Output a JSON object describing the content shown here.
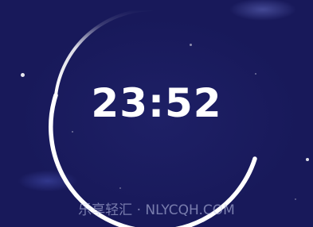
{
  "clock": {
    "time": "23:52"
  },
  "watermark": {
    "text": "乐享轻汇 · NLYCQH.COM"
  },
  "colors": {
    "background": "#1b1d5e",
    "ring": "#ffffff",
    "time_text": "#ffffff"
  },
  "icons": [
    "ring-progress-arc",
    "star-dot"
  ]
}
